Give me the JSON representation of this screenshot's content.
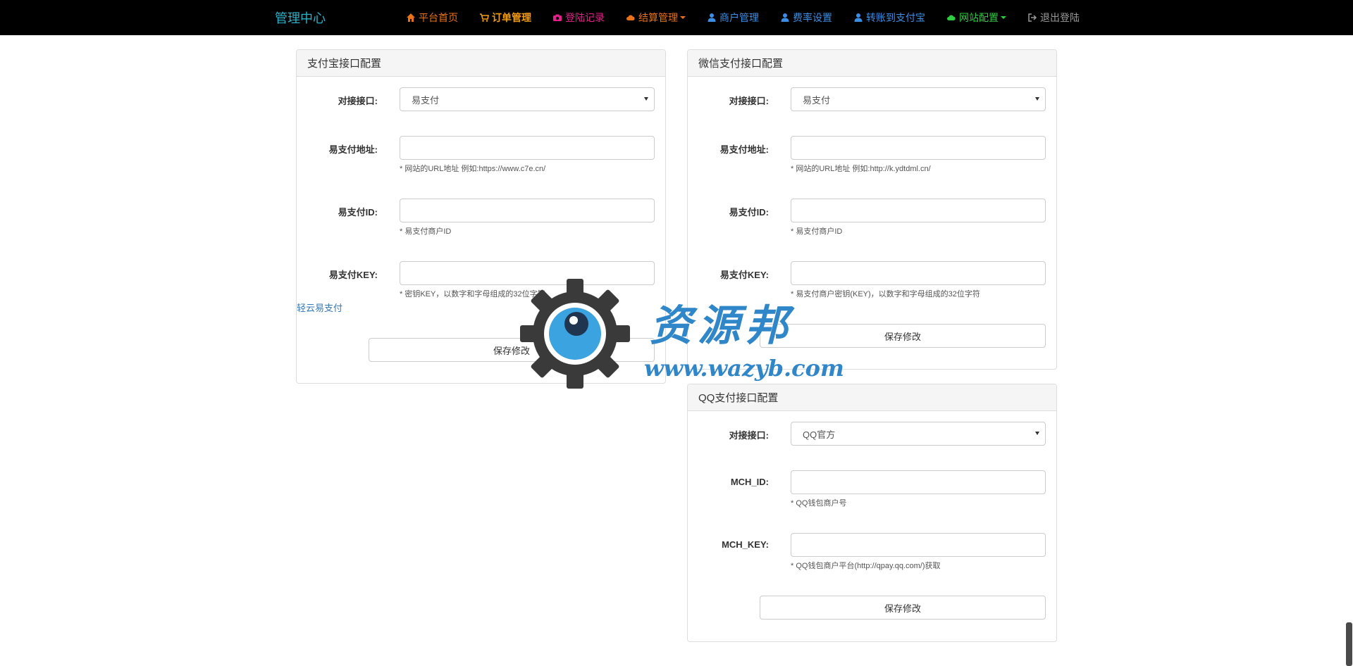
{
  "navbar": {
    "brand": "管理中心",
    "items": [
      {
        "label": "平台首页",
        "icon": "home-icon",
        "color": "#e8711a"
      },
      {
        "label": "订单管理",
        "icon": "cart-icon",
        "color": "#f39c12"
      },
      {
        "label": "登陆记录",
        "icon": "camera-icon",
        "color": "#e91e8c"
      },
      {
        "label": "结算管理",
        "icon": "cloud-icon",
        "color": "#e8711a"
      },
      {
        "label": "商户管理",
        "icon": "user-icon",
        "color": "#3a8ee6"
      },
      {
        "label": "费率设置",
        "icon": "user-icon",
        "color": "#3a8ee6"
      },
      {
        "label": "转账到支付宝",
        "icon": "user-icon",
        "color": "#3a8ee6"
      },
      {
        "label": "网站配置",
        "icon": "cloud-icon",
        "color": "#2ecc40"
      },
      {
        "label": "退出登陆",
        "icon": "logout-icon",
        "color": "#999999"
      }
    ]
  },
  "alipay": {
    "title": "支付宝接口配置",
    "interface_label": "对接接口:",
    "interface_value": "易支付",
    "url_label": "易支付地址:",
    "url_value": "",
    "url_help": "* 网站的URL地址 例如:https://www.c7e.cn/",
    "id_label": "易支付ID:",
    "id_value": "",
    "id_help": "* 易支付商户ID",
    "key_label": "易支付KEY:",
    "key_value": "",
    "key_help": "* 密钥KEY，以数字和字母组成的32位字符",
    "link": "轻云易支付",
    "save": "保存修改"
  },
  "wechat": {
    "title": "微信支付接口配置",
    "interface_label": "对接接口:",
    "interface_value": "易支付",
    "url_label": "易支付地址:",
    "url_value": "",
    "url_help": "* 网站的URL地址 例如:http://k.ydtdml.cn/",
    "id_label": "易支付ID:",
    "id_value": "",
    "id_help": "* 易支付商户ID",
    "key_label": "易支付KEY:",
    "key_value": "",
    "key_help": "* 易支付商户密钥(KEY)，以数字和字母组成的32位字符",
    "save": "保存修改"
  },
  "qq": {
    "title": "QQ支付接口配置",
    "interface_label": "对接接口:",
    "interface_value": "QQ官方",
    "mchid_label": "MCH_ID:",
    "mchid_value": "",
    "mchid_help": "* QQ钱包商户号",
    "mchkey_label": "MCH_KEY:",
    "mchkey_value": "",
    "mchkey_help": "* QQ钱包商户平台(http://qpay.qq.com/)获取",
    "save": "保存修改"
  },
  "watermark": {
    "text": "资源邦",
    "url": "www.wazyb.com"
  }
}
